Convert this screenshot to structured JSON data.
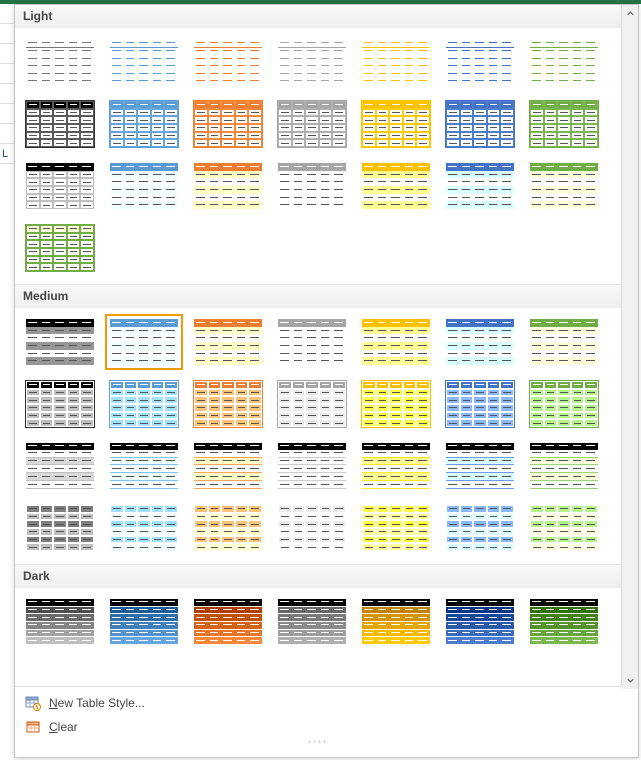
{
  "sections": {
    "light": {
      "title": "Light"
    },
    "medium": {
      "title": "Medium"
    },
    "dark": {
      "title": "Dark"
    }
  },
  "menu": {
    "new_style": "New Table Style...",
    "clear": "Clear"
  },
  "palette": {
    "none": "#9e9e9e",
    "blue": "#5b9bd5",
    "orange": "#ed7d31",
    "gray": "#a5a5a5",
    "gold": "#ffc000",
    "lblue": "#4472c4",
    "green": "#70ad47",
    "black": "#000000",
    "white": "#ffffff"
  },
  "light_rows": [
    {
      "variant": "plain",
      "items": [
        {
          "accent": "none"
        },
        {
          "accent": "blue"
        },
        {
          "accent": "orange"
        },
        {
          "accent": "gray"
        },
        {
          "accent": "gold"
        },
        {
          "accent": "lblue"
        },
        {
          "accent": "green"
        }
      ]
    },
    {
      "variant": "header-solid-bordered",
      "items": [
        {
          "accent": "black"
        },
        {
          "accent": "blue"
        },
        {
          "accent": "orange"
        },
        {
          "accent": "gray"
        },
        {
          "accent": "gold"
        },
        {
          "accent": "lblue"
        },
        {
          "accent": "green"
        }
      ]
    },
    {
      "variant": "banded-header",
      "items": [
        {
          "accent": "black"
        },
        {
          "accent": "blue"
        },
        {
          "accent": "orange"
        },
        {
          "accent": "gray"
        },
        {
          "accent": "gold"
        },
        {
          "accent": "lblue"
        },
        {
          "accent": "green"
        }
      ]
    },
    {
      "variant": "bordered-light",
      "items": [
        {
          "accent": "green"
        }
      ]
    }
  ],
  "medium_rows": [
    {
      "variant": "header-solid",
      "items": [
        {
          "accent": "black",
          "selected": false
        },
        {
          "accent": "blue",
          "selected": true
        },
        {
          "accent": "orange"
        },
        {
          "accent": "gray"
        },
        {
          "accent": "gold"
        },
        {
          "accent": "lblue"
        },
        {
          "accent": "green"
        }
      ]
    },
    {
      "variant": "grid-dark-header",
      "items": [
        {
          "accent": "black"
        },
        {
          "accent": "blue"
        },
        {
          "accent": "orange"
        },
        {
          "accent": "gray"
        },
        {
          "accent": "gold"
        },
        {
          "accent": "lblue"
        },
        {
          "accent": "green"
        }
      ]
    },
    {
      "variant": "banded-strong",
      "items": [
        {
          "accent": "black"
        },
        {
          "accent": "blue"
        },
        {
          "accent": "orange"
        },
        {
          "accent": "gray"
        },
        {
          "accent": "gold"
        },
        {
          "accent": "lblue"
        },
        {
          "accent": "green"
        }
      ]
    },
    {
      "variant": "grid-solid",
      "items": [
        {
          "accent": "black"
        },
        {
          "accent": "blue"
        },
        {
          "accent": "orange"
        },
        {
          "accent": "gray"
        },
        {
          "accent": "gold"
        },
        {
          "accent": "lblue"
        },
        {
          "accent": "green"
        }
      ]
    }
  ],
  "dark_rows": [
    {
      "variant": "dark-solid",
      "items": [
        {
          "accent": "black"
        },
        {
          "accent": "blue"
        },
        {
          "accent": "orange"
        },
        {
          "accent": "gray"
        },
        {
          "accent": "gold"
        },
        {
          "accent": "lblue"
        },
        {
          "accent": "green"
        }
      ]
    }
  ]
}
